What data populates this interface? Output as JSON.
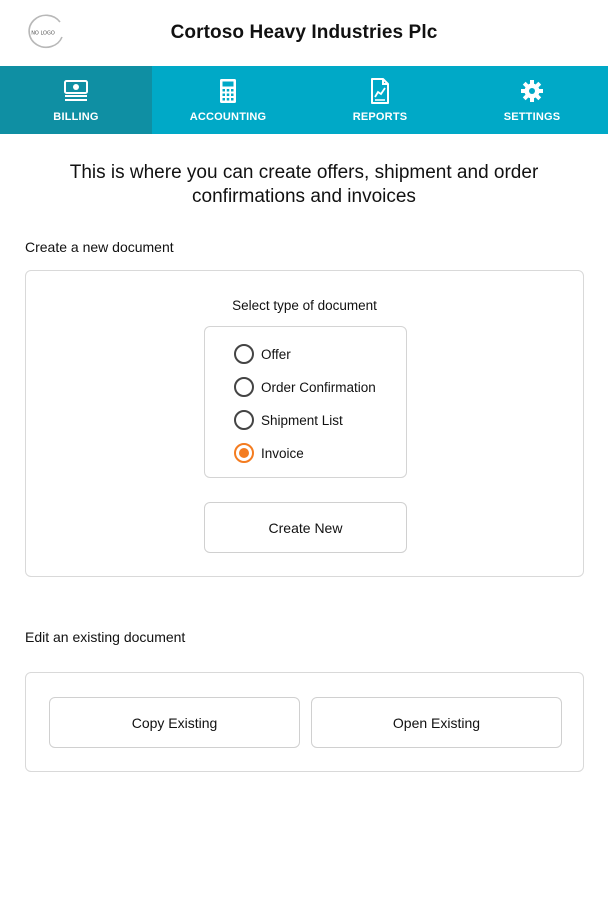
{
  "header": {
    "logo_text": "NO LOGO",
    "company_name": "Cortoso Heavy Industries Plc"
  },
  "nav": {
    "tabs": [
      {
        "label": "BILLING",
        "icon": "money-icon",
        "active": true
      },
      {
        "label": "ACCOUNTING",
        "icon": "calculator-icon",
        "active": false
      },
      {
        "label": "REPORTS",
        "icon": "report-chart-icon",
        "active": false
      },
      {
        "label": "SETTINGS",
        "icon": "gear-icon",
        "active": false
      }
    ],
    "color": "#00a9c7",
    "active_color": "#0f8fa3"
  },
  "main": {
    "intro": "This is where you can create offers, shipment and order confirmations and invoices",
    "create_section": {
      "title": "Create a new document",
      "select_label": "Select type of document",
      "options": [
        {
          "label": "Offer",
          "checked": false
        },
        {
          "label": "Order Confirmation",
          "checked": false
        },
        {
          "label": "Shipment List",
          "checked": false
        },
        {
          "label": "Invoice",
          "checked": true
        }
      ],
      "selected_color": "#f47c20",
      "create_button": "Create New"
    },
    "edit_section": {
      "title": "Edit an existing document",
      "copy_button": "Copy Existing",
      "open_button": "Open Existing"
    }
  }
}
